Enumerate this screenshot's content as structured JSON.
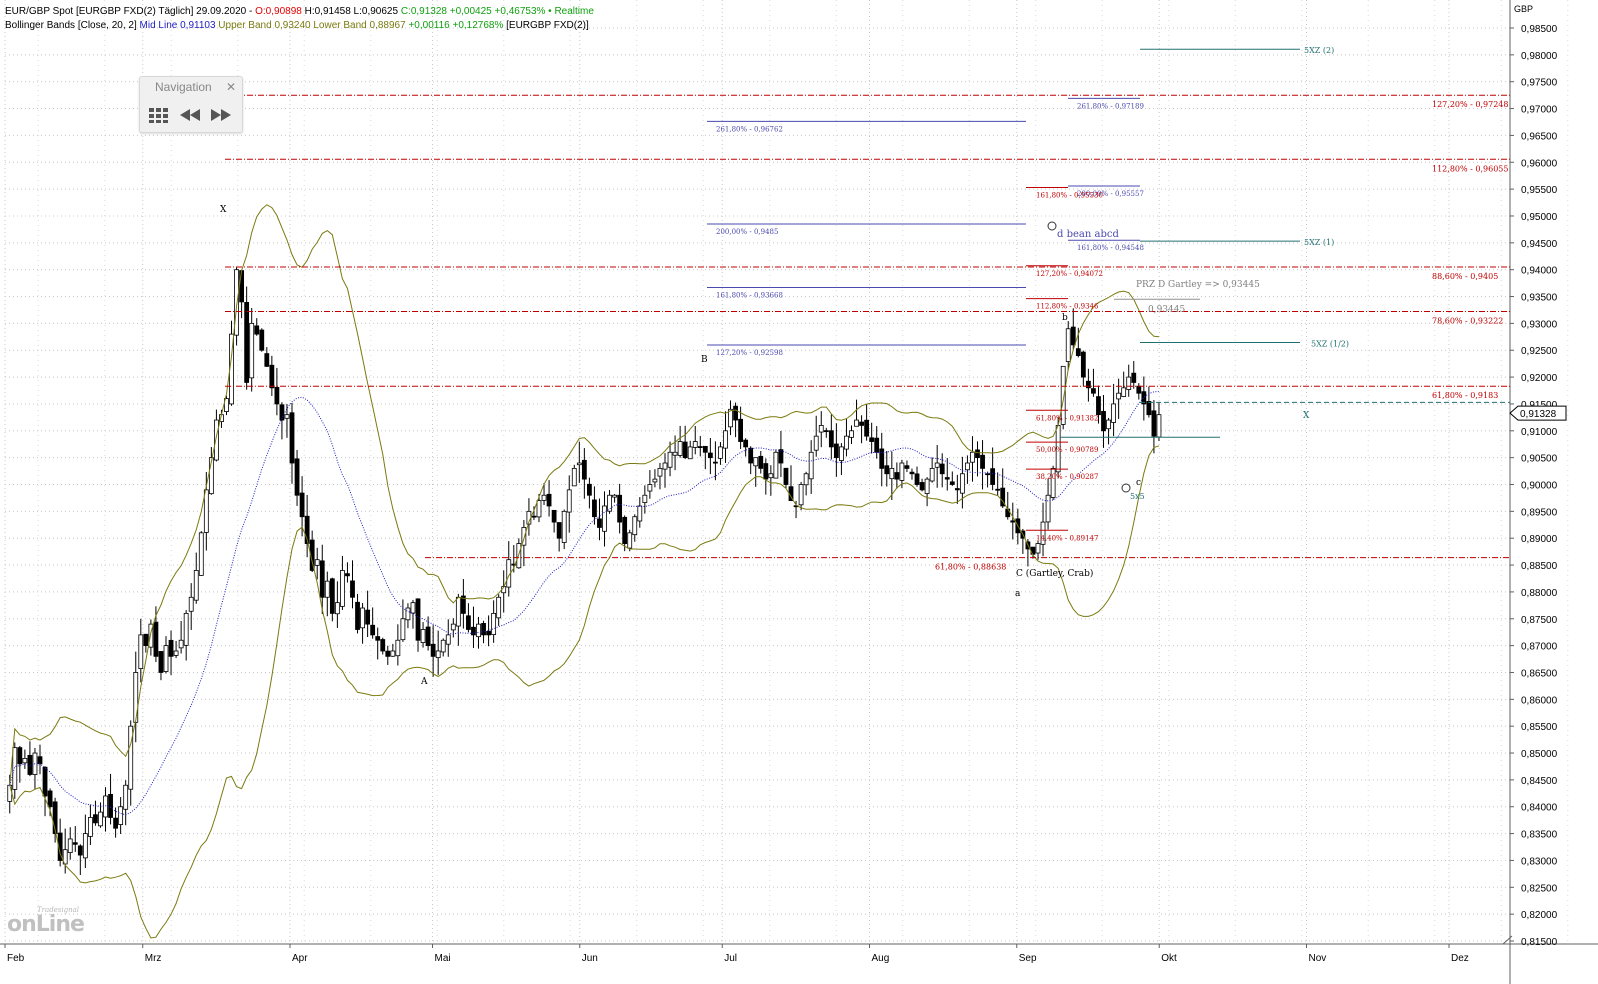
{
  "header": {
    "line1": [
      {
        "text": "EUR/GBP Spot [EURGBP FXD(2) Täglich] 29.09.2020 - ",
        "color": "#000000"
      },
      {
        "text": "O:0,90898",
        "color": "#e00000"
      },
      {
        "text": " H:0,91458 L:0,90625 ",
        "color": "#000000"
      },
      {
        "text": "C:0,91328 +0,00425 +0,46753% • Realtime",
        "color": "#10a010"
      }
    ],
    "line2": [
      {
        "text": "Bollinger Bands [Close, 20, 2] ",
        "color": "#000000"
      },
      {
        "text": "Mid Line 0,91103 ",
        "color": "#2020c0"
      },
      {
        "text": "Upper Band 0,93240 Lower Band 0,88967 ",
        "color": "#7a7a10"
      },
      {
        "text": "+0,00116 +0,12768%",
        "color": "#10a010"
      },
      {
        "text": " [EURGBP FXD(2)]",
        "color": "#000000"
      }
    ]
  },
  "navigation": {
    "title": "Navigation",
    "close_icon": "close-icon",
    "buttons": [
      "grid-icon",
      "rewind-icon",
      "fast-forward-icon"
    ]
  },
  "logo": {
    "small": "Tradesignal",
    "big": "onLine"
  },
  "chart_data": {
    "type": "candlestick",
    "instrument": "EUR/GBP",
    "axis_unit": "GBP",
    "ylim": [
      0.81,
      0.99
    ],
    "y_ticks": [
      "0,81500",
      "0,82000",
      "0,82500",
      "0,83000",
      "0,83500",
      "0,84000",
      "0,84500",
      "0,85000",
      "0,85500",
      "0,86000",
      "0,86500",
      "0,87000",
      "0,87500",
      "0,88000",
      "0,88500",
      "0,89000",
      "0,89500",
      "0,90000",
      "0,90500",
      "0,91000",
      "0,91500",
      "0,92000",
      "0,92500",
      "0,93000",
      "0,93500",
      "0,94000",
      "0,94500",
      "0,95000",
      "0,95500",
      "0,96000",
      "0,96500",
      "0,97000",
      "0,97500",
      "0,98000",
      "0,98500"
    ],
    "y_tick_values": [
      0.815,
      0.82,
      0.825,
      0.83,
      0.835,
      0.84,
      0.845,
      0.85,
      0.855,
      0.86,
      0.865,
      0.87,
      0.875,
      0.88,
      0.885,
      0.89,
      0.895,
      0.9,
      0.905,
      0.91,
      0.915,
      0.92,
      0.925,
      0.93,
      0.935,
      0.94,
      0.945,
      0.95,
      0.955,
      0.96,
      0.965,
      0.97,
      0.975,
      0.98,
      0.985
    ],
    "x_months": [
      {
        "label": "Feb",
        "day": 0
      },
      {
        "label": "Mrz",
        "day": 29
      },
      {
        "label": "Apr",
        "day": 60
      },
      {
        "label": "Mai",
        "day": 90
      },
      {
        "label": "Jun",
        "day": 121
      },
      {
        "label": "Jul",
        "day": 151
      },
      {
        "label": "Aug",
        "day": 182
      },
      {
        "label": "Sep",
        "day": 213
      },
      {
        "label": "Okt",
        "day": 243
      },
      {
        "label": "Nov",
        "day": 274
      },
      {
        "label": "Dez",
        "day": 304
      }
    ],
    "x_range_days": [
      0,
      335
    ],
    "last_price_label": "0,91328",
    "last_price": 0.91328,
    "closes": [
      0.844,
      0.851,
      0.848,
      0.849,
      0.846,
      0.85,
      0.848,
      0.842,
      0.84,
      0.835,
      0.83,
      0.832,
      0.834,
      0.833,
      0.831,
      0.835,
      0.838,
      0.837,
      0.839,
      0.842,
      0.838,
      0.836,
      0.84,
      0.844,
      0.855,
      0.865,
      0.872,
      0.87,
      0.874,
      0.868,
      0.865,
      0.87,
      0.868,
      0.869,
      0.871,
      0.876,
      0.879,
      0.884,
      0.891,
      0.899,
      0.905,
      0.912,
      0.913,
      0.916,
      0.928,
      0.94,
      0.934,
      0.919,
      0.93,
      0.928,
      0.925,
      0.922,
      0.918,
      0.915,
      0.912,
      0.913,
      0.904,
      0.898,
      0.894,
      0.889,
      0.884,
      0.886,
      0.879,
      0.882,
      0.876,
      0.878,
      0.884,
      0.883,
      0.879,
      0.873,
      0.877,
      0.874,
      0.872,
      0.871,
      0.869,
      0.868,
      0.869,
      0.871,
      0.875,
      0.877,
      0.878,
      0.871,
      0.873,
      0.87,
      0.868,
      0.869,
      0.871,
      0.872,
      0.874,
      0.879,
      0.876,
      0.873,
      0.872,
      0.874,
      0.872,
      0.872,
      0.876,
      0.879,
      0.881,
      0.886,
      0.885,
      0.889,
      0.892,
      0.895,
      0.894,
      0.897,
      0.898,
      0.896,
      0.893,
      0.89,
      0.895,
      0.899,
      0.903,
      0.904,
      0.901,
      0.898,
      0.894,
      0.892,
      0.896,
      0.898,
      0.898,
      0.893,
      0.889,
      0.891,
      0.894,
      0.896,
      0.898,
      0.9,
      0.901,
      0.903,
      0.904,
      0.906,
      0.906,
      0.908,
      0.905,
      0.907,
      0.908,
      0.907,
      0.906,
      0.905,
      0.904,
      0.907,
      0.91,
      0.914,
      0.912,
      0.908,
      0.907,
      0.904,
      0.905,
      0.903,
      0.901,
      0.902,
      0.906,
      0.904,
      0.9,
      0.897,
      0.896,
      0.9,
      0.902,
      0.906,
      0.909,
      0.911,
      0.91,
      0.907,
      0.905,
      0.907,
      0.909,
      0.91,
      0.912,
      0.911,
      0.909,
      0.908,
      0.906,
      0.903,
      0.902,
      0.903,
      0.901,
      0.904,
      0.903,
      0.902,
      0.9,
      0.899,
      0.901,
      0.903,
      0.904,
      0.902,
      0.901,
      0.9,
      0.899,
      0.902,
      0.904,
      0.906,
      0.905,
      0.903,
      0.902,
      0.9,
      0.899,
      0.896,
      0.894,
      0.893,
      0.891,
      0.89,
      0.888,
      0.887,
      0.889,
      0.893,
      0.898,
      0.903,
      0.911,
      0.922,
      0.929,
      0.926,
      0.924,
      0.92,
      0.918,
      0.917,
      0.913,
      0.91,
      0.912,
      0.915,
      0.917,
      0.918,
      0.92,
      0.919,
      0.917,
      0.915,
      0.913,
      0.909,
      0.913
    ],
    "fib_red": [
      {
        "label": "127,20% - 0,97248",
        "value": 0.97248
      },
      {
        "label": "112,80% - 0,96055",
        "value": 0.96055
      },
      {
        "label": "88,60% - 0,9405",
        "value": 0.9405
      },
      {
        "label": "78,60% - 0,93222",
        "value": 0.93222
      },
      {
        "label": "61,80% - 0,9183",
        "value": 0.9183
      },
      {
        "label": "61,80% - 0,88638",
        "value": 0.88638
      }
    ],
    "fib_blue_left": [
      {
        "label": "261,80% - 0,96762",
        "value": 0.96762
      },
      {
        "label": "200,00% - 0,9485",
        "value": 0.9485
      },
      {
        "label": "161,80% - 0,93668",
        "value": 0.93668
      },
      {
        "label": "127,20% - 0,92598",
        "value": 0.92598
      }
    ],
    "fib_blue_right": [
      {
        "label": "261,80% - 0,97189",
        "value": 0.97189
      },
      {
        "label": "200,00% - 0,95557",
        "value": 0.95557
      },
      {
        "label": "161,80% - 0,94548",
        "value": 0.94548
      }
    ],
    "fib_red_small": [
      {
        "label": "161,80% - 0,95530",
        "value": 0.9553
      },
      {
        "label": "127,20% - 0,94072",
        "value": 0.94072
      },
      {
        "label": "112,80% - 0,9346",
        "value": 0.9346
      },
      {
        "label": "61,80% - 0,91382",
        "value": 0.91382
      },
      {
        "label": "50,00% - 0,90789",
        "value": 0.90789
      },
      {
        "label": "38,20% - 0,90287",
        "value": 0.90287
      },
      {
        "label": "14,40% - 0,89147",
        "value": 0.89147
      }
    ],
    "teal_levels": [
      {
        "label": "5XZ (2)",
        "value": 0.98105
      },
      {
        "label": "5XZ (1)",
        "value": 0.94532
      },
      {
        "label": "5XZ (1/2)",
        "value": 0.92645
      }
    ],
    "annotations": {
      "X": "X",
      "A": "A",
      "B": "B",
      "C": "C (Gartley, Crab)",
      "a": "a",
      "b": "b",
      "c": "c",
      "d_bean": "d bean abcd",
      "prz": "PRZ D Gartley => 0,93445",
      "prz_value_label": "0,93445",
      "x_right": "X",
      "fivexfive": "5x5"
    },
    "series": [
      {
        "name": "Mid Line",
        "color": "#2020c0"
      },
      {
        "name": "Upper Band",
        "color": "#7a7a10"
      },
      {
        "name": "Lower Band",
        "color": "#7a7a10"
      }
    ],
    "colors": {
      "red_level": "#c00000",
      "blue_level": "#4a4ab0",
      "teal_level": "#207070",
      "band": "#7a7a10",
      "mid": "#2020c0"
    }
  }
}
